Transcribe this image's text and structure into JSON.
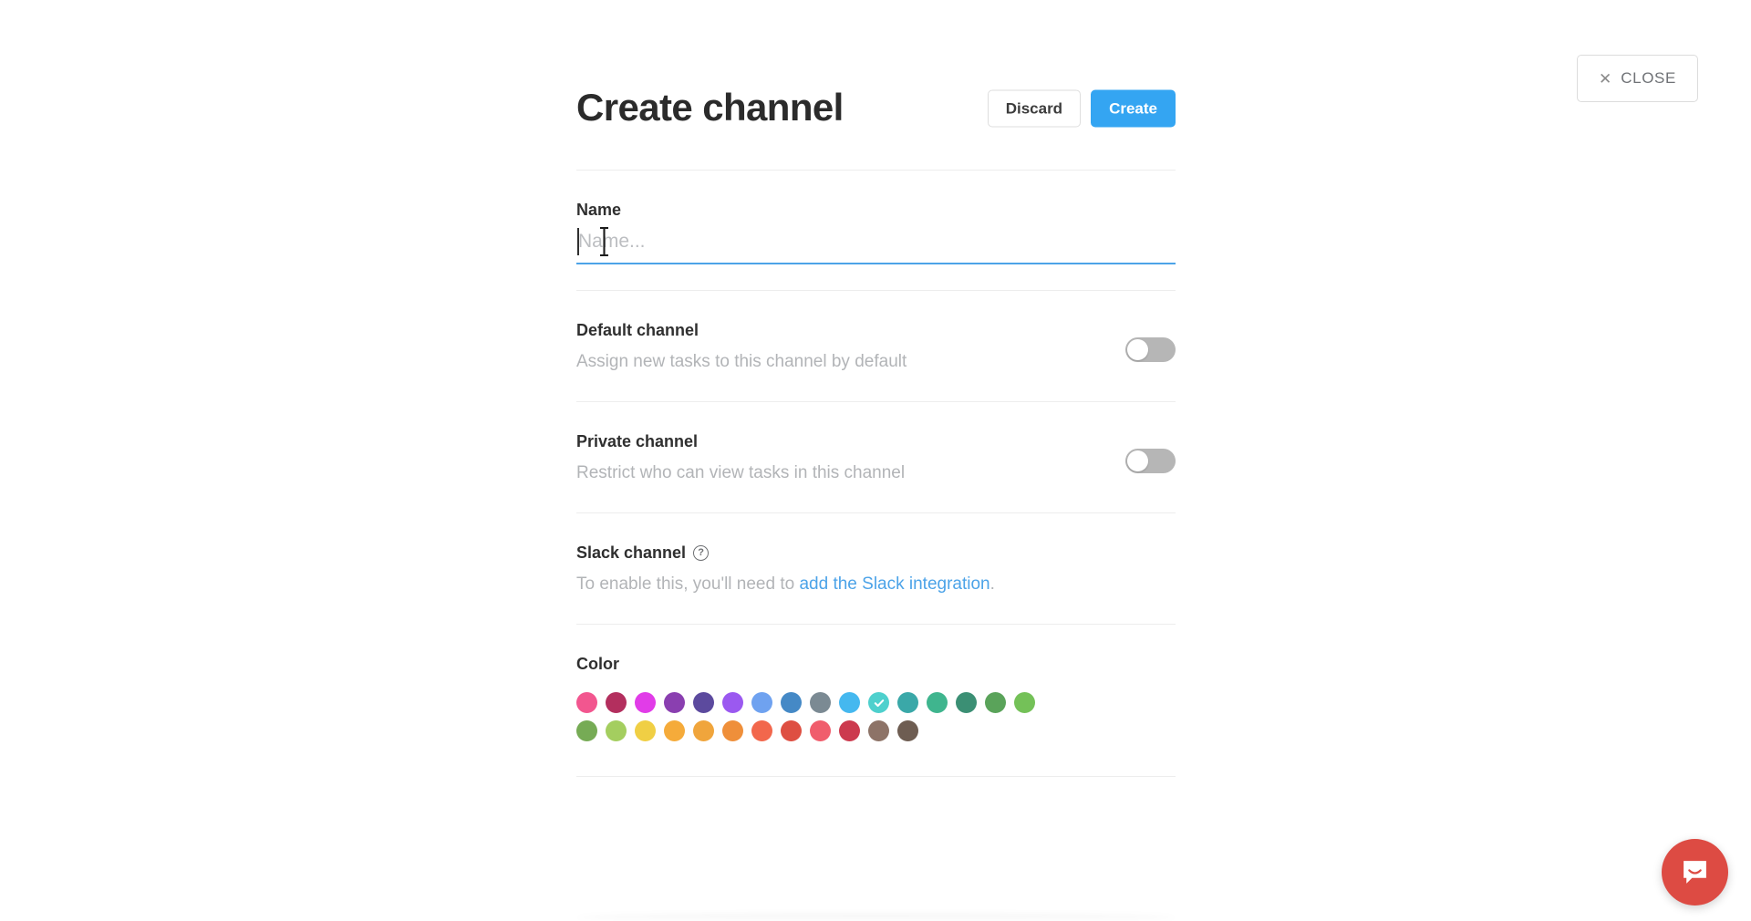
{
  "window": {
    "close_button": {
      "label": "CLOSE",
      "icon": "close-x-icon"
    }
  },
  "header": {
    "title": "Create channel",
    "discard_label": "Discard",
    "create_label": "Create",
    "create_color": "#34a5f2"
  },
  "fields": {
    "name": {
      "label": "Name",
      "placeholder": "Name...",
      "value": "",
      "focused": true,
      "underline_color": "#4ca3e8"
    },
    "default_channel": {
      "label": "Default channel",
      "description": "Assign new tasks to this channel by default",
      "toggle_state": "off"
    },
    "private_channel": {
      "label": "Private channel",
      "description": "Restrict who can view tasks in this channel",
      "toggle_state": "off"
    },
    "slack_channel": {
      "label": "Slack channel",
      "help_icon": "question-mark-icon",
      "description_prefix": "To enable this, you'll need to ",
      "link_text": "add the Slack integration",
      "description_suffix": "."
    },
    "color": {
      "label": "Color",
      "selected_index": 10,
      "selected_color": "#4ed0cd",
      "rows": [
        [
          "#f2568f",
          "#b32f5e",
          "#e13ce8",
          "#8a3fb0",
          "#5c4a9e",
          "#9b59f0",
          "#6fa2f0",
          "#4589c6",
          "#7b8a93",
          "#45b8ef",
          "#4ed0cd",
          "#3aa8a8",
          "#3fb58e",
          "#3b8f74",
          "#5aa35a",
          "#74c158"
        ],
        [
          "#76ab55",
          "#a4ce5f",
          "#f0cf44",
          "#f5ab3a",
          "#f0a53c",
          "#ef8f3a",
          "#f2674c",
          "#de4f42",
          "#f05d6c",
          "#cc3a4e",
          "#8d7367",
          "#6e5d52"
        ]
      ]
    }
  },
  "support": {
    "launcher": "intercom-messenger-icon"
  }
}
